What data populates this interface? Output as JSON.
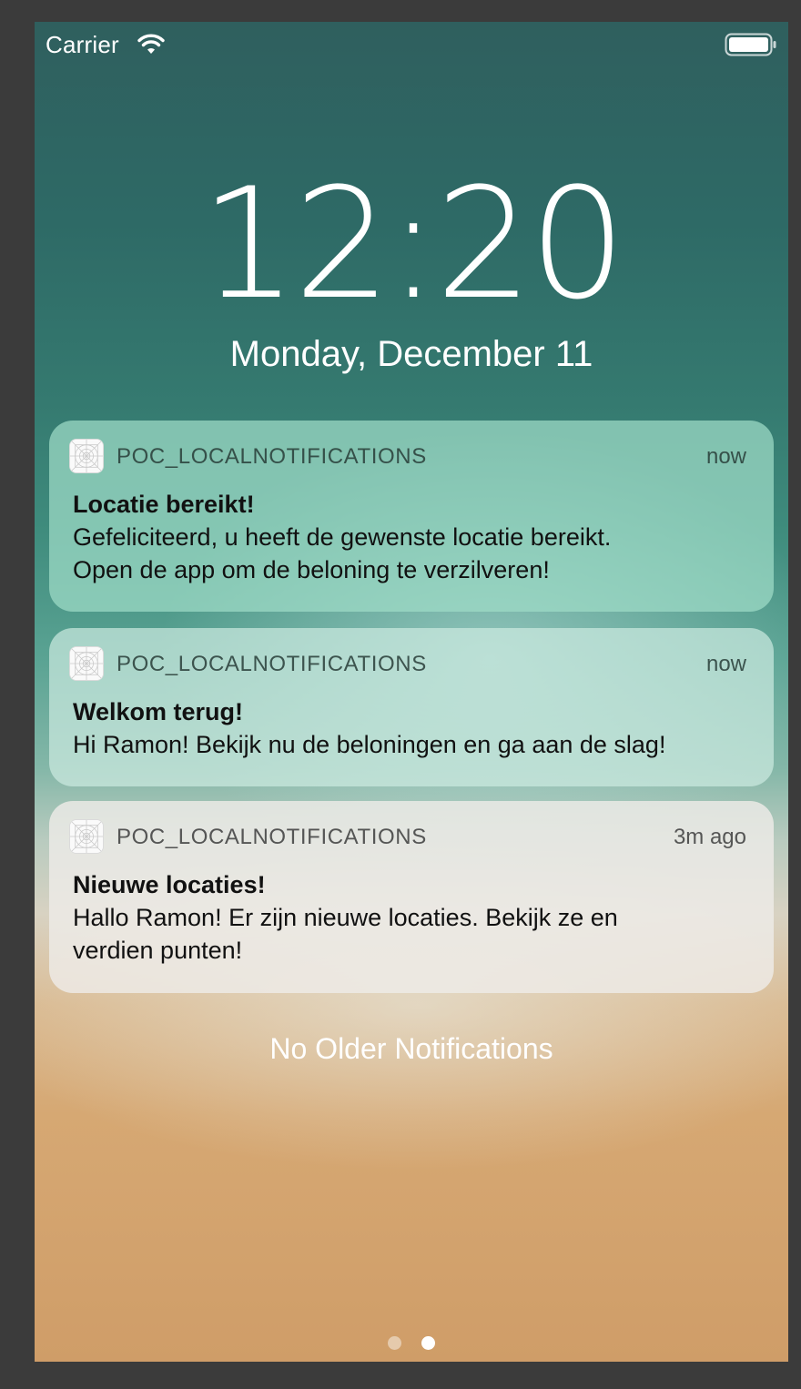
{
  "status_bar": {
    "carrier": "Carrier",
    "wifi_icon": "wifi-icon",
    "battery_icon": "battery-icon"
  },
  "lock_screen": {
    "time": "12:20",
    "date": "Monday, December 11"
  },
  "notifications": [
    {
      "app": "POC_LOCALNOTIFICATIONS",
      "time": "now",
      "title": "Locatie bereikt!",
      "body": "Gefeliciteerd, u heeft de gewenste locatie bereikt.\nOpen de app om de beloning te verzilveren!",
      "icon": "app-placeholder-icon"
    },
    {
      "app": "POC_LOCALNOTIFICATIONS",
      "time": "now",
      "title": "Welkom terug!",
      "body": "Hi Ramon! Bekijk nu de beloningen en ga aan de slag!",
      "icon": "app-placeholder-icon"
    },
    {
      "app": "POC_LOCALNOTIFICATIONS",
      "time": "3m ago",
      "title": "Nieuwe locaties!",
      "body": "Hallo Ramon! Er zijn nieuwe locaties. Bekijk ze en\nverdien punten!",
      "icon": "app-placeholder-icon"
    }
  ],
  "footer_text": "No Older Notifications",
  "page_indicator": {
    "pages": 2,
    "active_index": 1
  },
  "colors": {
    "frame": "#3b3b3b",
    "text_light": "#ffffff",
    "text_dark": "#111111"
  }
}
